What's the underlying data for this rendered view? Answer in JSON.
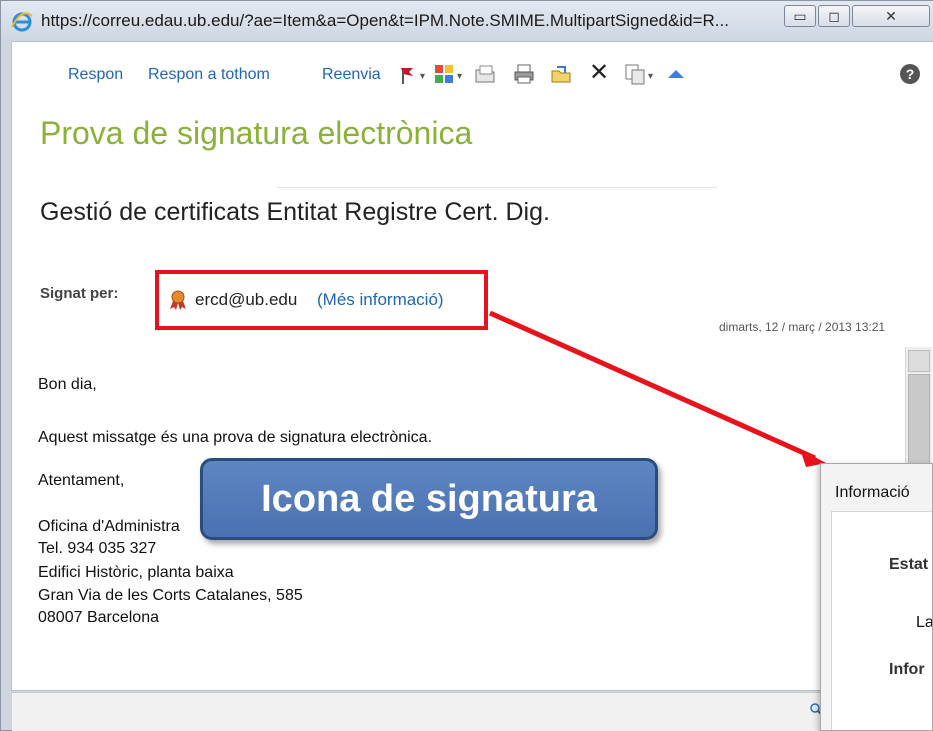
{
  "window": {
    "url": "https://correu.edau.ub.edu/?ae=Item&a=Open&t=IPM.Note.SMIME.MultipartSigned&id=R...",
    "icons": [
      "ie-icon",
      "minimize-icon",
      "maximize-icon",
      "close-icon"
    ]
  },
  "toolbar": {
    "reply_label": "Respon",
    "reply_all_label": "Respon a tothom",
    "forward_label": "Reenvia",
    "icons": [
      "flag-icon",
      "categories-icon",
      "open-folder-icon",
      "print-icon",
      "move-icon",
      "delete-icon",
      "copy-icon",
      "up-icon",
      "help-icon"
    ]
  },
  "message": {
    "subject": "Prova de signatura electrònica",
    "from": "Gestió de certificats Entitat Registre Cert. Dig.",
    "signed_label": "Signat per:",
    "signer_email": "ercd@ub.edu",
    "more_info_label": "(Més informació)",
    "date": "dimarts, 12 / març / 2013 13:21",
    "body": [
      "Bon dia,",
      "Aquest missatge és una prova de signatura electrònica.",
      "Atentament,",
      "Oficina d'Administra",
      "Tel. 934 035 327",
      "Edifici Històric, planta baixa",
      "Gran Via de les Corts Catalanes, 585",
      "08007 Barcelona"
    ]
  },
  "callout": {
    "text": "Icona de signatura"
  },
  "info_dialog": {
    "title": "Informació",
    "estat": "Estat",
    "la": "La",
    "infor": "Infor"
  },
  "colors": {
    "accent": "#1f67b3",
    "subject": "#8ab13a",
    "highlight": "#e8131a",
    "callout": "#4b72b0"
  }
}
